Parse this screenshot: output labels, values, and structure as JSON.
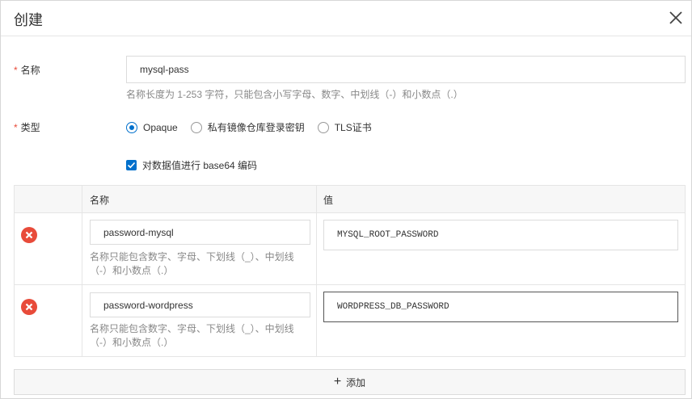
{
  "dialog": {
    "title": "创建",
    "close_icon": "close-icon"
  },
  "form": {
    "name": {
      "required_mark": "*",
      "label": "名称",
      "value": "mysql-pass",
      "hint": "名称长度为 1-253 字符，只能包含小写字母、数字、中划线（-）和小数点（.）"
    },
    "type": {
      "required_mark": "*",
      "label": "类型",
      "options": [
        {
          "label": "Opaque",
          "checked": true
        },
        {
          "label": "私有镜像仓库登录密钥",
          "checked": false
        },
        {
          "label": "TLS证书",
          "checked": false
        }
      ]
    },
    "base64": {
      "label": "对数据值进行 base64 编码",
      "checked": true
    }
  },
  "table": {
    "headers": {
      "name": "名称",
      "value": "值"
    },
    "rows": [
      {
        "key": "password-mysql",
        "value": "MYSQL_ROOT_PASSWORD",
        "hint_line1": "名称只能包含数字、字母、下划线（_）、中划线",
        "hint_line2": "（-）和小数点（.）"
      },
      {
        "key": "password-wordpress",
        "value": "WORDPRESS_DB_PASSWORD",
        "hint_line1": "名称只能包含数字、字母、下划线（_）、中划线",
        "hint_line2": "（-）和小数点（.）"
      }
    ]
  },
  "add_button": {
    "icon": "plus-icon",
    "label": "添加"
  },
  "colors": {
    "accent": "#0070cc",
    "danger": "#e84b3a",
    "hint": "#888888",
    "border": "#dcdcdc"
  }
}
